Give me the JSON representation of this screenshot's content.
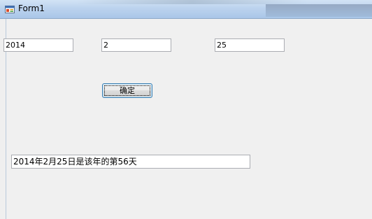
{
  "window": {
    "title": "Form1"
  },
  "icons": {
    "app": "form-window-icon"
  },
  "colors": {
    "titlebar": "#bcd3ee",
    "client_background": "#f0f0f0",
    "button_border": "#3c7fb1"
  },
  "form": {
    "year_value": "2014",
    "month_value": "2",
    "day_value": "25",
    "confirm_label": "确定",
    "result_value": "2014年2月25日是该年的第56天"
  }
}
